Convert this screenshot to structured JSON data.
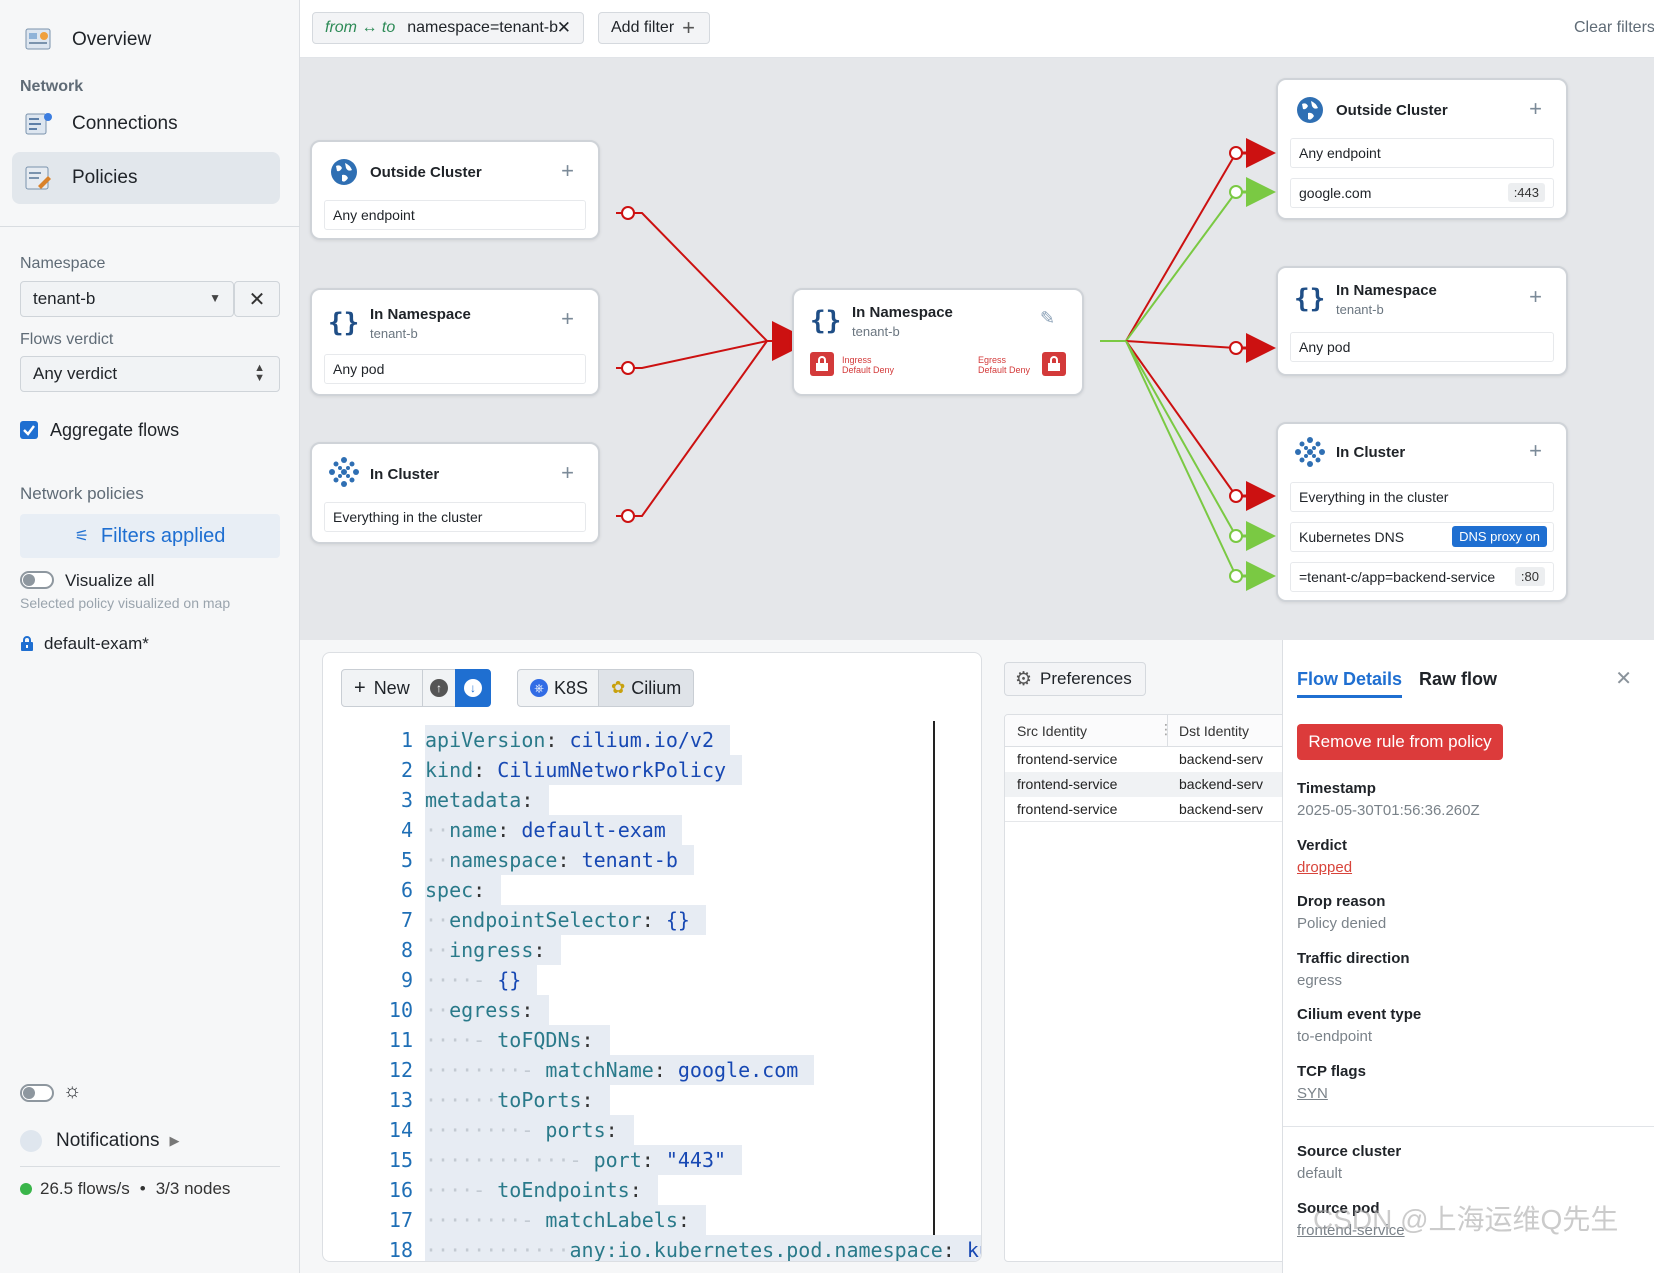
{
  "sidebar": {
    "overview": "Overview",
    "network_heading": "Network",
    "connections": "Connections",
    "policies": "Policies",
    "namespace_label": "Namespace",
    "namespace_value": "tenant-b",
    "verdict_label": "Flows verdict",
    "verdict_value": "Any verdict",
    "aggregate_label": "Aggregate flows",
    "network_policies_label": "Network policies",
    "filters_applied": "Filters applied",
    "visualize_all": "Visualize all",
    "visualize_hint": "Selected policy visualized on map",
    "policy_name": "default-exam*",
    "notifications": "Notifications",
    "flow_rate": "26.5 flows/s",
    "nodes": "3/3 nodes",
    "status_dot_color": "#3ab54a"
  },
  "filterbar": {
    "direction": "from ↔ to",
    "filter_value": "namespace=tenant-b",
    "add_filter": "Add filter",
    "clear_filters": "Clear filters"
  },
  "map": {
    "left_cards": [
      {
        "title": "Outside Cluster",
        "subtitle": "",
        "row": "Any endpoint",
        "icon": "globe-icon"
      },
      {
        "title": "In Namespace",
        "subtitle": "tenant-b",
        "row": "Any pod",
        "icon": "braces-icon"
      },
      {
        "title": "In Cluster",
        "subtitle": "",
        "row": "Everything in the cluster",
        "icon": "cluster-icon"
      }
    ],
    "center_card": {
      "title": "In Namespace",
      "subtitle": "tenant-b",
      "ingress_label": "Ingress",
      "ingress_value": "Default Deny",
      "egress_label": "Egress",
      "egress_value": "Default Deny"
    },
    "right_cards": [
      {
        "title": "Outside Cluster",
        "subtitle": "",
        "rows": [
          {
            "text": "Any endpoint",
            "badge": ""
          },
          {
            "text": "google.com",
            "badge": ":443"
          }
        ]
      },
      {
        "title": "In Namespace",
        "subtitle": "tenant-b",
        "rows": [
          {
            "text": "Any pod",
            "badge": ""
          }
        ]
      },
      {
        "title": "In Cluster",
        "subtitle": "",
        "rows": [
          {
            "text": "Everything in the cluster",
            "badge": ""
          },
          {
            "text": "Kubernetes DNS",
            "badge": "DNS proxy on"
          },
          {
            "text": "=tenant-c/app=backend-service",
            "badge": ":80"
          }
        ]
      }
    ],
    "colors": {
      "denied": "#cc1111",
      "allowed": "#7ac943",
      "deny_box": "#d33a3a"
    }
  },
  "editor": {
    "new_label": "New",
    "k8s_label": "K8S",
    "cilium_label": "Cilium",
    "lines": [
      {
        "n": "1",
        "indent": "",
        "key": "apiVersion",
        "val": "cilium.io/v2"
      },
      {
        "n": "2",
        "indent": "",
        "key": "kind",
        "val": "CiliumNetworkPolicy"
      },
      {
        "n": "3",
        "indent": "",
        "key": "metadata",
        "val": ""
      },
      {
        "n": "4",
        "indent": "··",
        "key": "name",
        "val": "default-exam"
      },
      {
        "n": "5",
        "indent": "··",
        "key": "namespace",
        "val": "tenant-b"
      },
      {
        "n": "6",
        "indent": "",
        "key": "spec",
        "val": ""
      },
      {
        "n": "7",
        "indent": "··",
        "key": "endpointSelector",
        "val": "{}"
      },
      {
        "n": "8",
        "indent": "··",
        "key": "ingress",
        "val": ""
      },
      {
        "n": "9",
        "indent": "····- ",
        "key": "",
        "val": "{}"
      },
      {
        "n": "10",
        "indent": "··",
        "key": "egress",
        "val": ""
      },
      {
        "n": "11",
        "indent": "····- ",
        "key": "toFQDNs",
        "val": ""
      },
      {
        "n": "12",
        "indent": "········- ",
        "key": "matchName",
        "val": "google.com"
      },
      {
        "n": "13",
        "indent": "······",
        "key": "toPorts",
        "val": ""
      },
      {
        "n": "14",
        "indent": "········- ",
        "key": "ports",
        "val": ""
      },
      {
        "n": "15",
        "indent": "············- ",
        "key": "port",
        "val": "\"443\""
      },
      {
        "n": "16",
        "indent": "····- ",
        "key": "toEndpoints",
        "val": ""
      },
      {
        "n": "17",
        "indent": "········- ",
        "key": "matchLabels",
        "val": ""
      },
      {
        "n": "18",
        "indent": "············",
        "key": "any:io.kubernetes.pod.namespace",
        "val": "ku"
      }
    ]
  },
  "flows": {
    "preferences": "Preferences",
    "columns": [
      "Src Identity",
      "Dst Identity"
    ],
    "rows": [
      [
        "frontend-service",
        "backend-serv"
      ],
      [
        "frontend-service",
        "backend-serv"
      ],
      [
        "frontend-service",
        "backend-serv"
      ]
    ]
  },
  "details": {
    "tab_flow_details": "Flow Details",
    "tab_raw_flow": "Raw flow",
    "remove_button": "Remove rule from policy",
    "fields": [
      {
        "label": "Timestamp",
        "value": "2025-05-30T01:56:36.260Z",
        "style": "plain"
      },
      {
        "label": "Verdict",
        "value": "dropped",
        "style": "red"
      },
      {
        "label": "Drop reason",
        "value": "Policy denied",
        "style": "plain"
      },
      {
        "label": "Traffic direction",
        "value": "egress",
        "style": "plain"
      },
      {
        "label": "Cilium event type",
        "value": "to-endpoint",
        "style": "plain"
      },
      {
        "label": "TCP flags",
        "value": "SYN",
        "style": "underline"
      },
      {
        "label": "Source cluster",
        "value": "default",
        "style": "plain"
      },
      {
        "label": "Source pod",
        "value": "frontend-service",
        "style": "underline"
      }
    ],
    "watermark": "CSDN @上海运维Q先生"
  }
}
